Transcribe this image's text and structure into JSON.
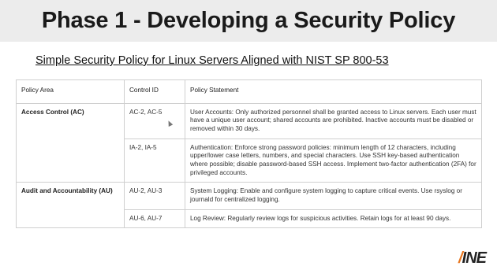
{
  "slide": {
    "title": "Phase 1  - Developing a Security Policy",
    "subtitle": "Simple Security Policy for Linux Servers Aligned with NIST SP 800-53"
  },
  "table": {
    "headers": [
      "Policy Area",
      "Control ID",
      "Policy Statement"
    ],
    "rows": [
      {
        "area": "Access Control (AC)",
        "control": "AC-2, AC-5",
        "statement": "User Accounts: Only authorized personnel shall be granted access to Linux servers. Each user must have a unique user account; shared accounts are prohibited. Inactive accounts must be disabled or removed within 30 days."
      },
      {
        "area": "",
        "control": "IA-2, IA-5",
        "statement": "Authentication: Enforce strong password policies: minimum length of 12 characters, including upper/lower case letters, numbers, and special characters. Use SSH key-based authentication where possible; disable password-based SSH access. Implement two-factor authentication (2FA) for privileged accounts."
      },
      {
        "area": "Audit and Accountability (AU)",
        "control": "AU-2, AU-3",
        "statement": "System Logging: Enable and configure system logging to capture critical events. Use rsyslog or journald for centralized logging."
      },
      {
        "area": "",
        "control": "AU-6, AU-7",
        "statement": "Log Review: Regularly review logs for suspicious activities. Retain logs for at least 90 days."
      }
    ]
  },
  "logo": {
    "text_a": "/",
    "text_b": "INE"
  },
  "colors": {
    "title_band": "#ececec",
    "logo_accent": "#e8761e"
  }
}
